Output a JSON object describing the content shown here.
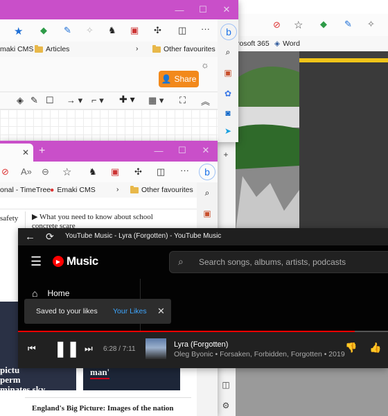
{
  "right_window": {
    "fav_items": [
      {
        "label": "rosoft 365"
      },
      {
        "label": "Word"
      }
    ]
  },
  "back_window": {
    "fav_items": [
      {
        "label": "maki CMS"
      },
      {
        "label": "Articles"
      },
      {
        "label": "Other favourites"
      }
    ],
    "share_label": "Share"
  },
  "mid_window": {
    "fav_items": [
      {
        "label": "onal - TimeTree"
      },
      {
        "label": "Emaki CMS"
      },
      {
        "label": "Other favourites"
      }
    ],
    "articles": [
      {
        "text": "safety"
      },
      {
        "text": "What you need to know about school concrete scare"
      }
    ],
    "cards": [
      {
        "text_l1": "pictu",
        "text_l2": "perm",
        "text_l3": "minates sky"
      },
      {
        "text": "man'"
      }
    ],
    "bottom_headline": "England's Big Picture: Images of the nation"
  },
  "music_window": {
    "title": "YouTube Music - Lyra (Forgotten) - YouTube Music",
    "logo_text": "Music",
    "search_placeholder": "Search songs, albums, artists, podcasts",
    "nav_home": "Home",
    "toast": {
      "message": "Saved to your likes",
      "action": "Your Likes"
    },
    "player": {
      "time": "6:28 / 7:11",
      "progress": 0.91,
      "track_title": "Lyra (Forgotten)",
      "track_meta": "Oleg Byonic • Forsaken, Forbidden, Forgotten • 2019"
    }
  },
  "colors": {
    "titlebar": "#c94fc9",
    "music_bg": "#030303",
    "accent_red": "#ff0000",
    "link_blue": "#3ea6ff",
    "share_orange": "#f2891b"
  }
}
